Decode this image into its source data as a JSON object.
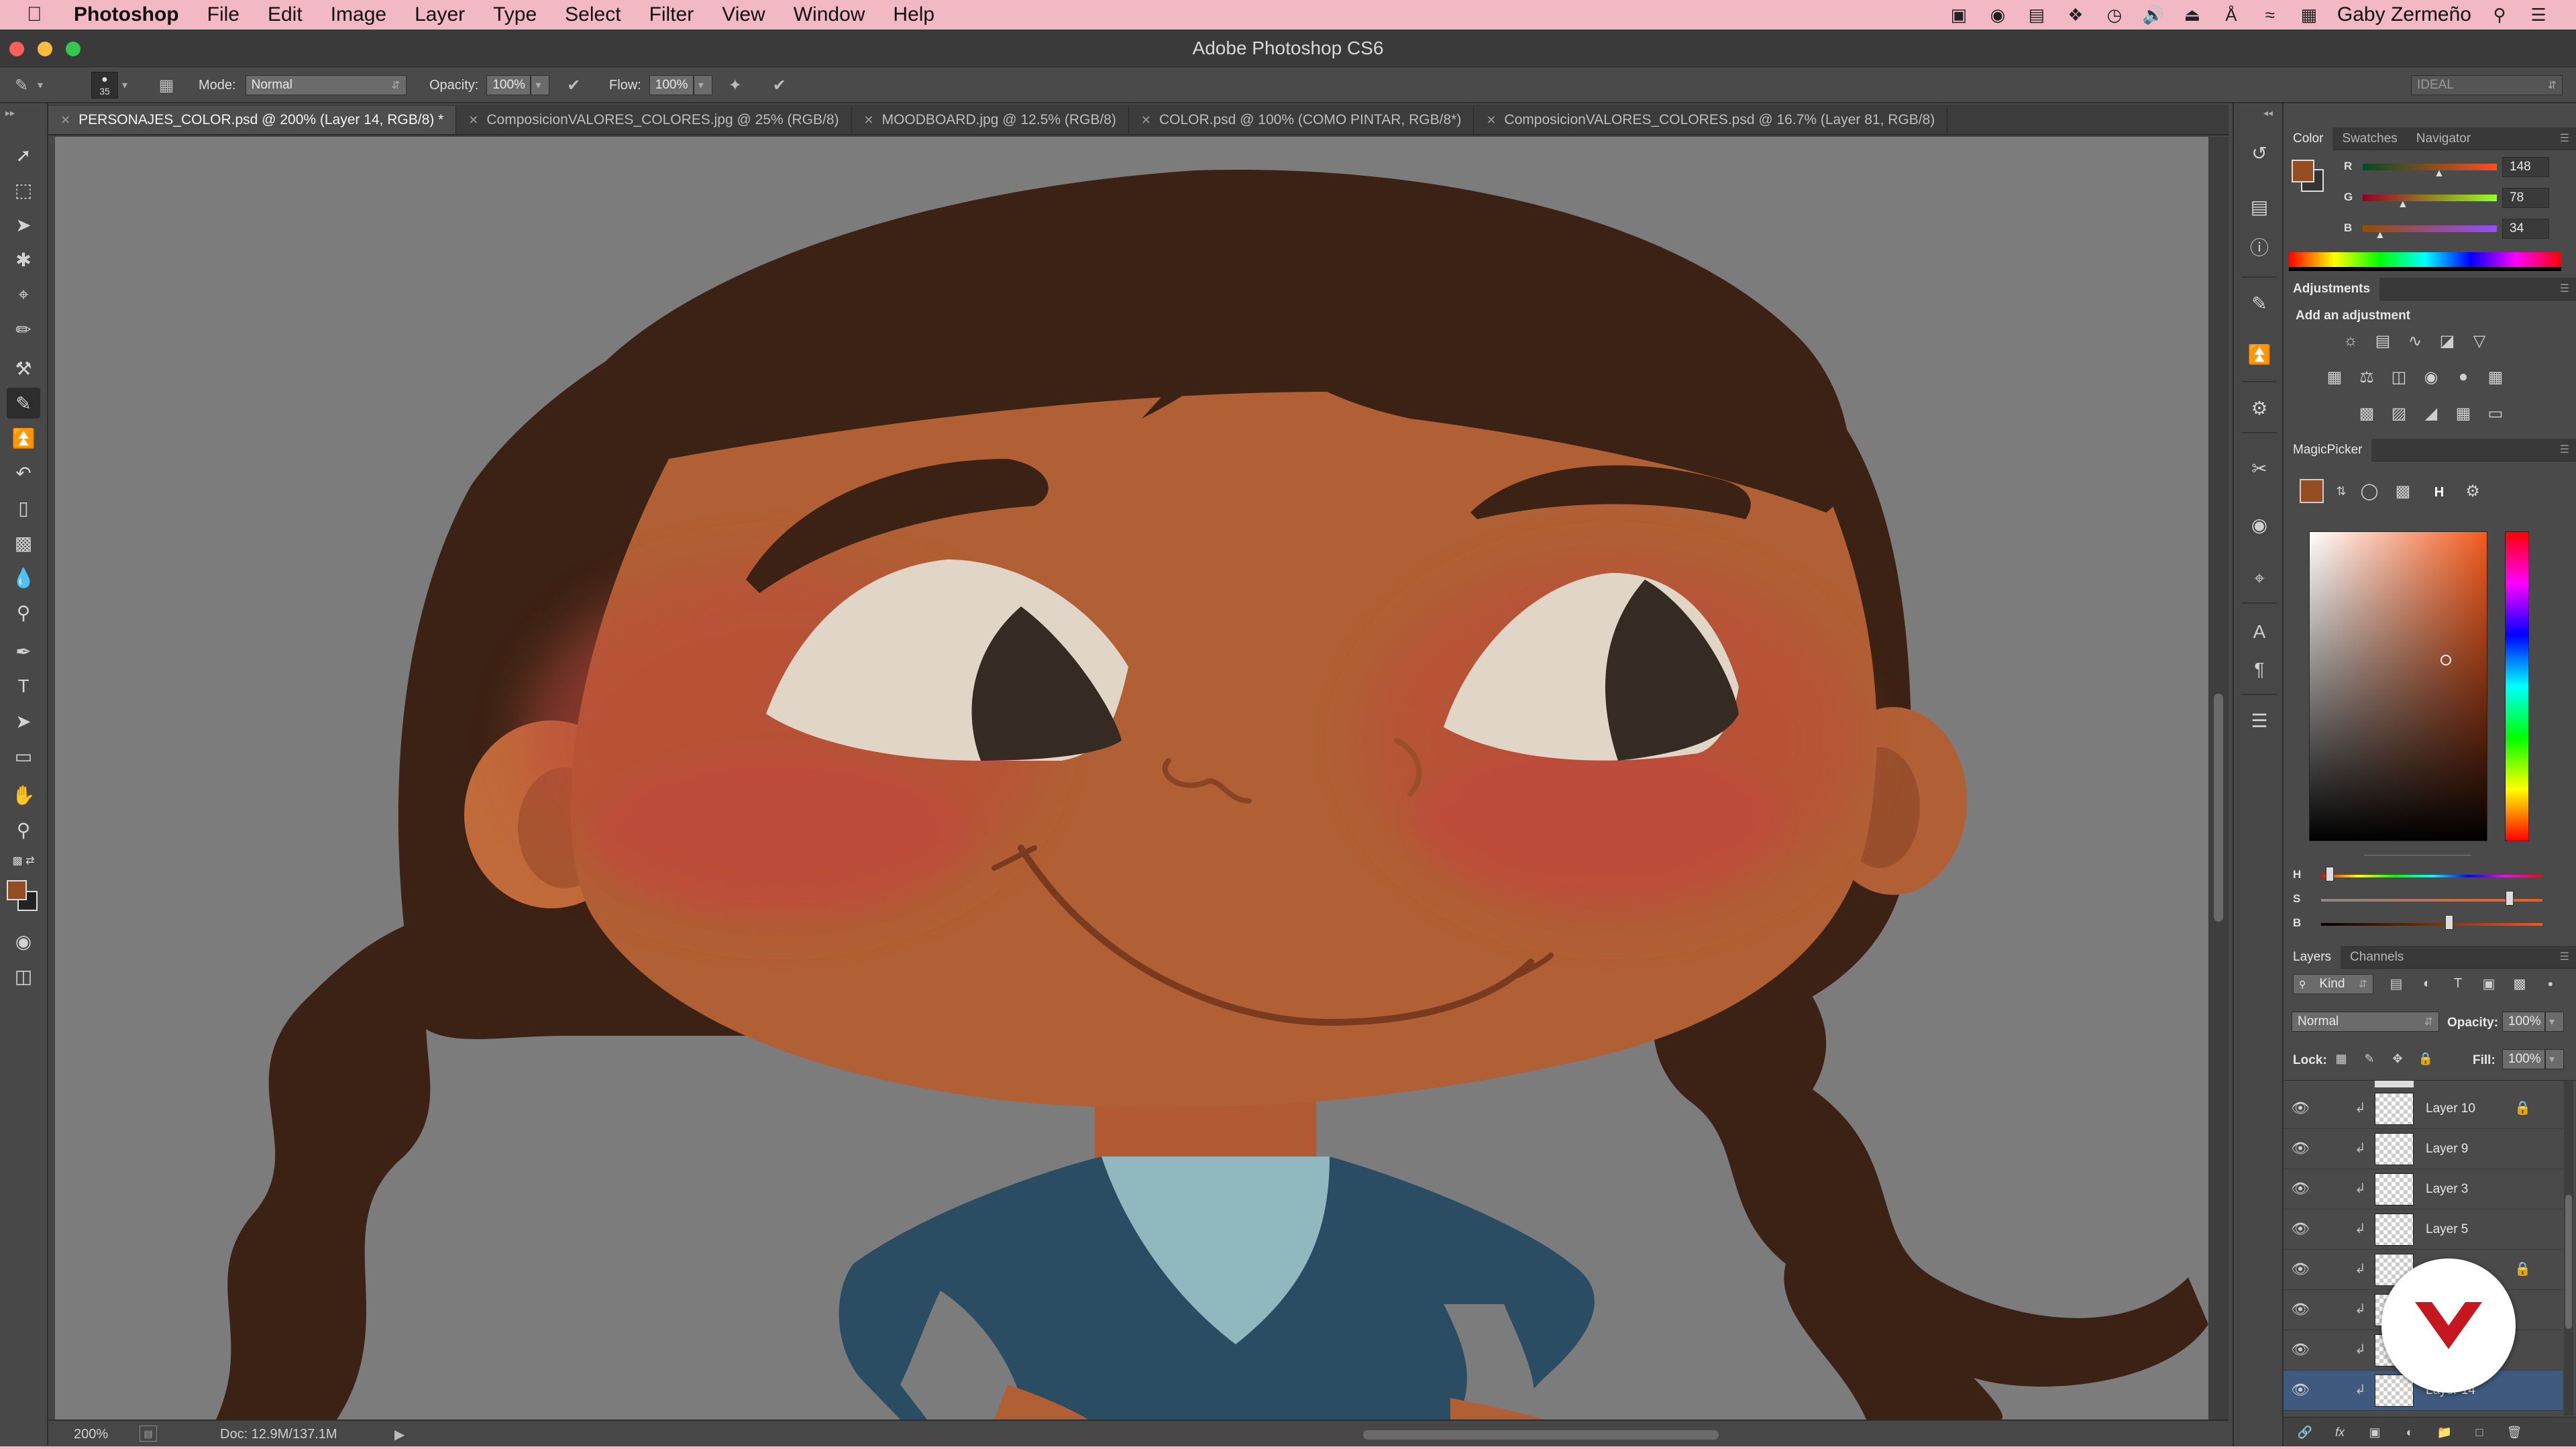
{
  "menubar": {
    "apple": "",
    "app": "Photoshop",
    "items": [
      "File",
      "Edit",
      "Image",
      "Layer",
      "Type",
      "Select",
      "Filter",
      "View",
      "Window",
      "Help"
    ],
    "user": "Gaby Zermeño",
    "system_icons": [
      "adobe-icon",
      "record-icon",
      "drive-icon",
      "dropbox-icon",
      "clock-icon",
      "volume-icon",
      "eject-icon",
      "bluetooth-icon",
      "wifi-icon",
      "calendar-icon"
    ]
  },
  "titlebar": {
    "title": "Adobe Photoshop CS6"
  },
  "options": {
    "brush_size": "35",
    "mode_label": "Mode:",
    "mode_value": "Normal",
    "opacity_label": "Opacity:",
    "opacity_value": "100%",
    "flow_label": "Flow:",
    "flow_value": "100%",
    "workspace": "IDEAL"
  },
  "tabs": [
    "PERSONAJES_COLOR.psd @ 200% (Layer 14, RGB/8) *",
    "ComposicionVALORES_COLORES.jpg @ 25% (RGB/8)",
    "MOODBOARD.jpg @ 12.5% (RGB/8)",
    "COLOR.psd @ 100% (COMO PINTAR, RGB/8*)",
    "ComposicionVALORES_COLORES.psd @ 16.7% (Layer 81, RGB/8)"
  ],
  "status": {
    "zoom": "200%",
    "doc": "Doc: 12.9M/137.1M"
  },
  "color_panel": {
    "tabs": [
      "Color",
      "Swatches",
      "Navigator"
    ],
    "r_label": "R",
    "r": "148",
    "g_label": "G",
    "g": "78",
    "b_label": "B",
    "b": "34",
    "foreground": "#944e22"
  },
  "adjustments": {
    "title": "Adjustments",
    "subtitle": "Add an adjustment"
  },
  "magicpicker": {
    "title": "MagicPicker",
    "mode_letter": "H",
    "h_label": "H",
    "s_label": "S",
    "b_label": "B",
    "h": 0.04,
    "s": 0.85,
    "b": 0.58
  },
  "layers": {
    "tabs": [
      "Layers",
      "Channels"
    ],
    "kind": "Kind",
    "blend": "Normal",
    "opacity_label": "Opacity:",
    "opacity": "100%",
    "lock_label": "Lock:",
    "fill_label": "Fill:",
    "fill": "100%",
    "items": [
      {
        "name": "Layer 10",
        "locked": true
      },
      {
        "name": "Layer 9",
        "locked": false
      },
      {
        "name": "Layer 3",
        "locked": false
      },
      {
        "name": "Layer 5",
        "locked": false
      },
      {
        "name": "",
        "locked": true
      },
      {
        "name": "",
        "locked": false
      },
      {
        "name": "",
        "locked": false
      },
      {
        "name": "Layer 14",
        "locked": false
      }
    ]
  },
  "colors": {
    "hair": "#3b2214",
    "skin": "#b15f34",
    "skin_light": "#c16a3a",
    "blush": "#bc4a3a",
    "eye_white": "#e1d5c8",
    "pupil": "#352b22",
    "shirt": "#2a4d63",
    "collar": "#90b8be",
    "canvas_bg": "#7c7c7c",
    "accent": "#c4171f"
  }
}
